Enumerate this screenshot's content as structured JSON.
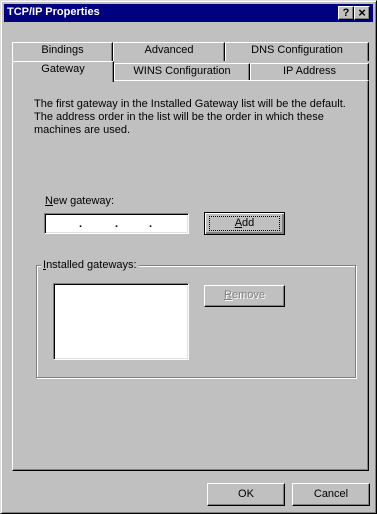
{
  "window": {
    "title": "TCP/IP Properties",
    "help_label": "?",
    "close_label": "×"
  },
  "tabs": {
    "back_row": [
      "Bindings",
      "Advanced",
      "DNS Configuration"
    ],
    "front_row": [
      "Gateway",
      "WINS Configuration",
      "IP Address"
    ],
    "active": "Gateway"
  },
  "gateway_page": {
    "description": "The first gateway in the Installed Gateway list will be the default. The address order in the list will be the order in which these machines are used.",
    "new_gateway_label_key": "N",
    "new_gateway_label_rest": "ew gateway:",
    "ip_separator": ".",
    "add_button_key": "A",
    "add_button_rest": "dd",
    "installed_label_key": "I",
    "installed_label_rest": "nstalled gateways:",
    "remove_button_key": "R",
    "remove_button_rest": "emove",
    "installed_gateways": []
  },
  "footer": {
    "ok_label": "OK",
    "cancel_label": "Cancel"
  }
}
